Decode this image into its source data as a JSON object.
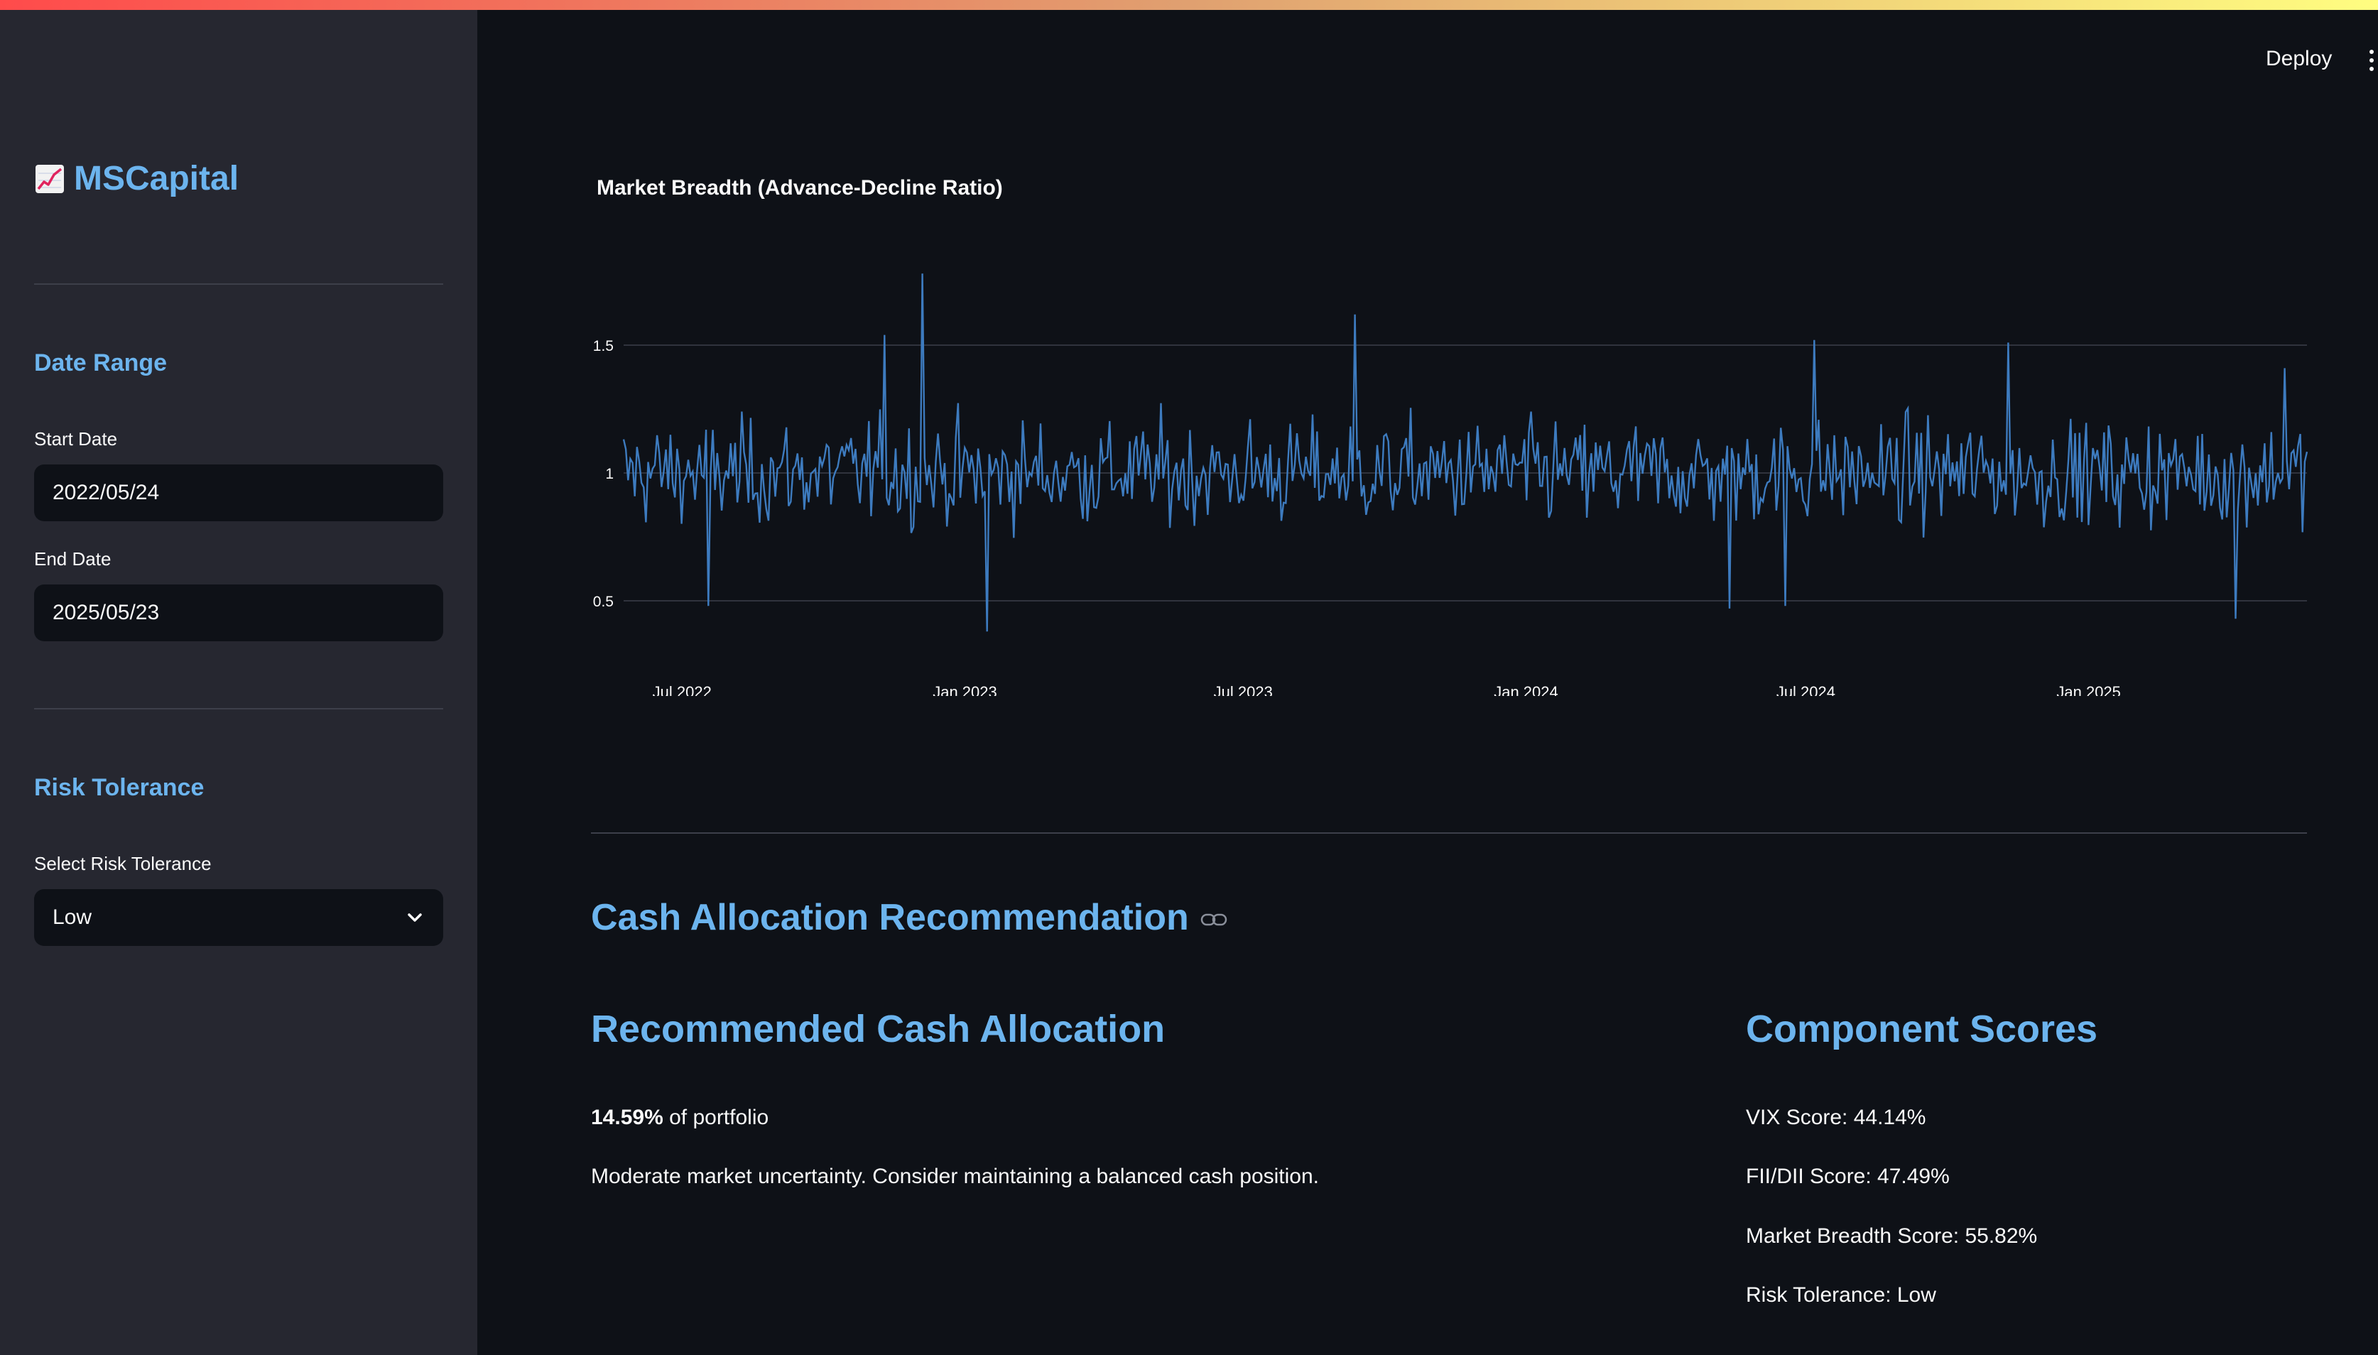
{
  "app": {
    "brand": "MSCapital",
    "brand_icon": "chart-increasing-icon",
    "deploy_label": "Deploy",
    "menu_icon": "kebab-menu-icon"
  },
  "sidebar": {
    "date_range": {
      "heading": "Date Range",
      "start_label": "Start Date",
      "start_value": "2022/05/24",
      "end_label": "End Date",
      "end_value": "2025/05/23"
    },
    "risk": {
      "heading": "Risk Tolerance",
      "select_label": "Select Risk Tolerance",
      "selected": "Low"
    }
  },
  "chart_data": {
    "type": "line",
    "title": "Market Breadth (Advance-Decline Ratio)",
    "xlabel": "",
    "ylabel": "",
    "ylim": [
      0.35,
      1.85
    ],
    "yticks": [
      0.5,
      1,
      1.5
    ],
    "ytick_labels": [
      "0.5",
      "1",
      "1.5"
    ],
    "xlim": [
      "2022-05-24",
      "2025-05-23"
    ],
    "xticks": [
      "2022-07-01",
      "2023-01-01",
      "2023-07-01",
      "2024-01-01",
      "2024-07-01",
      "2025-01-01"
    ],
    "xtick_labels": [
      "Jul 2022",
      "Jan 2023",
      "Jul 2023",
      "Jan 2024",
      "Jul 2024",
      "Jan 2025"
    ],
    "grid": true,
    "line_color": "#3d7bbf",
    "approx_mean": 1.0,
    "approx_min": 0.38,
    "approx_max": 1.78,
    "notable_points": [
      {
        "x": "2022-07-18",
        "y": 0.48
      },
      {
        "x": "2022-11-10",
        "y": 1.54
      },
      {
        "x": "2022-12-05",
        "y": 1.78
      },
      {
        "x": "2023-01-15",
        "y": 0.38
      },
      {
        "x": "2023-09-11",
        "y": 1.62
      },
      {
        "x": "2024-05-13",
        "y": 0.47
      },
      {
        "x": "2024-06-18",
        "y": 0.48
      },
      {
        "x": "2024-07-06",
        "y": 1.52
      },
      {
        "x": "2024-11-09",
        "y": 1.51
      },
      {
        "x": "2025-04-07",
        "y": 0.43
      },
      {
        "x": "2025-05-09",
        "y": 1.41
      }
    ]
  },
  "main": {
    "section_title": "Cash Allocation Recommendation",
    "section_link_icon": "link-icon",
    "recommended": {
      "heading": "Recommended Cash Allocation",
      "value": "14.59%",
      "value_suffix": "of portfolio",
      "note": "Moderate market uncertainty. Consider maintaining a balanced cash position."
    },
    "scores": {
      "heading": "Component Scores",
      "items": [
        "VIX Score: 44.14%",
        "FII/DII Score: 47.49%",
        "Market Breadth Score: 55.82%",
        "Risk Tolerance: Low"
      ]
    }
  }
}
